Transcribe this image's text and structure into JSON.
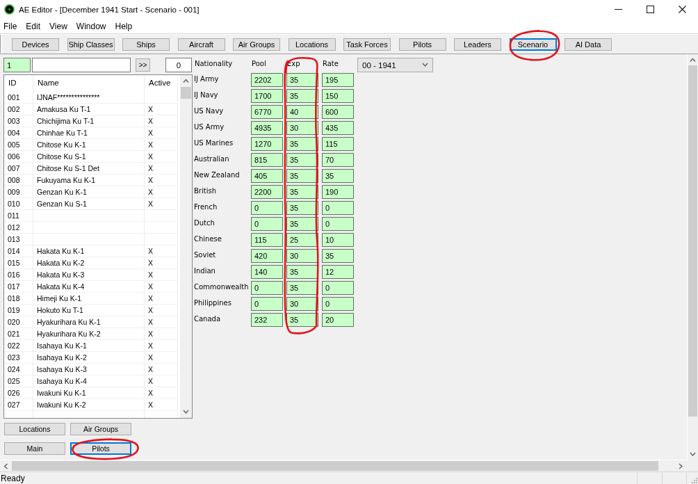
{
  "window": {
    "title": "AE Editor - [December 1941 Start - Scenario - 001]"
  },
  "menu": [
    "File",
    "Edit",
    "View",
    "Window",
    "Help"
  ],
  "toolbar": [
    {
      "label": "Devices",
      "selected": false,
      "circled": false
    },
    {
      "label": "Ship Classes",
      "selected": false,
      "circled": false
    },
    {
      "label": "Ships",
      "selected": false,
      "circled": false
    },
    {
      "label": "Aircraft",
      "selected": false,
      "circled": false
    },
    {
      "label": "Air Groups",
      "selected": false,
      "circled": false
    },
    {
      "label": "Locations",
      "selected": false,
      "circled": false
    },
    {
      "label": "Task Forces",
      "selected": false,
      "circled": false
    },
    {
      "label": "Pilots",
      "selected": false,
      "circled": false
    },
    {
      "label": "Leaders",
      "selected": false,
      "circled": false
    },
    {
      "label": "Scenario",
      "selected": true,
      "circled": true
    },
    {
      "label": "AI Data",
      "selected": false,
      "circled": false
    }
  ],
  "list_panel": {
    "id_field": {
      "value": "1"
    },
    "go_button": ">>",
    "count_field": {
      "value": "0"
    },
    "columns": [
      "ID",
      "Name",
      "Active"
    ],
    "rows": [
      {
        "id": "001",
        "name": "IJNAF***************"
      },
      {
        "id": "002",
        "name": "Amakusa Ku T-1",
        "active": "X"
      },
      {
        "id": "003",
        "name": "Chichijima Ku T-1",
        "active": "X"
      },
      {
        "id": "004",
        "name": "Chinhae Ku T-1",
        "active": "X"
      },
      {
        "id": "005",
        "name": "Chitose Ku K-1",
        "active": "X"
      },
      {
        "id": "006",
        "name": "Chitose Ku S-1",
        "active": "X"
      },
      {
        "id": "007",
        "name": "Chitose Ku S-1 Det",
        "active": "X"
      },
      {
        "id": "008",
        "name": "Fukuyama Ku K-1",
        "active": "X"
      },
      {
        "id": "009",
        "name": "Genzan Ku K-1",
        "active": "X"
      },
      {
        "id": "010",
        "name": "Genzan Ku S-1",
        "active": "X"
      },
      {
        "id": "011"
      },
      {
        "id": "012"
      },
      {
        "id": "013"
      },
      {
        "id": "014",
        "name": "Hakata Ku K-1",
        "active": "X"
      },
      {
        "id": "015",
        "name": "Hakata Ku K-2",
        "active": "X"
      },
      {
        "id": "016",
        "name": "Hakata Ku K-3",
        "active": "X"
      },
      {
        "id": "017",
        "name": "Hakata Ku K-4",
        "active": "X"
      },
      {
        "id": "018",
        "name": "Himeji Ku K-1",
        "active": "X"
      },
      {
        "id": "019",
        "name": "Hokuto Ku T-1",
        "active": "X"
      },
      {
        "id": "020",
        "name": "Hyakurihara Ku K-1",
        "active": "X"
      },
      {
        "id": "021",
        "name": "Hyakurihara Ku K-2",
        "active": "X"
      },
      {
        "id": "022",
        "name": "Isahaya Ku K-1",
        "active": "X"
      },
      {
        "id": "023",
        "name": "Isahaya Ku K-2",
        "active": "X"
      },
      {
        "id": "024",
        "name": "Isahaya Ku K-3",
        "active": "X"
      },
      {
        "id": "025",
        "name": "Isahaya Ku K-4",
        "active": "X"
      },
      {
        "id": "026",
        "name": "Iwakuni Ku K-1",
        "active": "X"
      },
      {
        "id": "027",
        "name": "Iwakuni Ku K-2",
        "active": "X"
      }
    ],
    "buttons": [
      {
        "label": "Locations",
        "selected": false,
        "circled": false
      },
      {
        "label": "Air Groups",
        "selected": false,
        "circled": false
      },
      {
        "label": "Main",
        "selected": false,
        "circled": false
      },
      {
        "label": "Pilots",
        "selected": true,
        "circled": true
      }
    ]
  },
  "nationality_table": {
    "columns": [
      {
        "label": "Nationality",
        "kind": "label",
        "circled": false
      },
      {
        "label": "Pool",
        "kind": "field",
        "circled": false
      },
      {
        "label": "Exp",
        "kind": "field",
        "circled": true
      },
      {
        "label": "Rate",
        "kind": "field",
        "circled": false
      }
    ],
    "rows": [
      {
        "cells": [
          "IJ Army",
          "2202",
          "35",
          "195"
        ]
      },
      {
        "cells": [
          "IJ Navy",
          "1700",
          "35",
          "150"
        ]
      },
      {
        "cells": [
          "US Navy",
          "6770",
          "40",
          "600"
        ]
      },
      {
        "cells": [
          "US Army",
          "4935",
          "30",
          "435"
        ]
      },
      {
        "cells": [
          "US Marines",
          "1270",
          "35",
          "115"
        ]
      },
      {
        "cells": [
          "Australian",
          "815",
          "35",
          "70"
        ]
      },
      {
        "cells": [
          "New Zealand",
          "405",
          "35",
          "35"
        ]
      },
      {
        "cells": [
          "British",
          "2200",
          "35",
          "190"
        ]
      },
      {
        "cells": [
          "French",
          "0",
          "35",
          "0"
        ]
      },
      {
        "cells": [
          "Dutch",
          "0",
          "35",
          "0"
        ]
      },
      {
        "cells": [
          "Chinese",
          "115",
          "25",
          "10"
        ]
      },
      {
        "cells": [
          "Soviet",
          "420",
          "30",
          "35"
        ]
      },
      {
        "cells": [
          "Indian",
          "140",
          "35",
          "12"
        ]
      },
      {
        "cells": [
          "Commonwealth",
          "0",
          "35",
          "0"
        ]
      },
      {
        "cells": [
          "Philippines",
          "0",
          "30",
          "0"
        ]
      },
      {
        "cells": [
          "Canada",
          "232",
          "35",
          "20"
        ]
      }
    ]
  },
  "year_select": {
    "value": "00 - 1941"
  },
  "status_bar": {
    "text": "Ready"
  }
}
